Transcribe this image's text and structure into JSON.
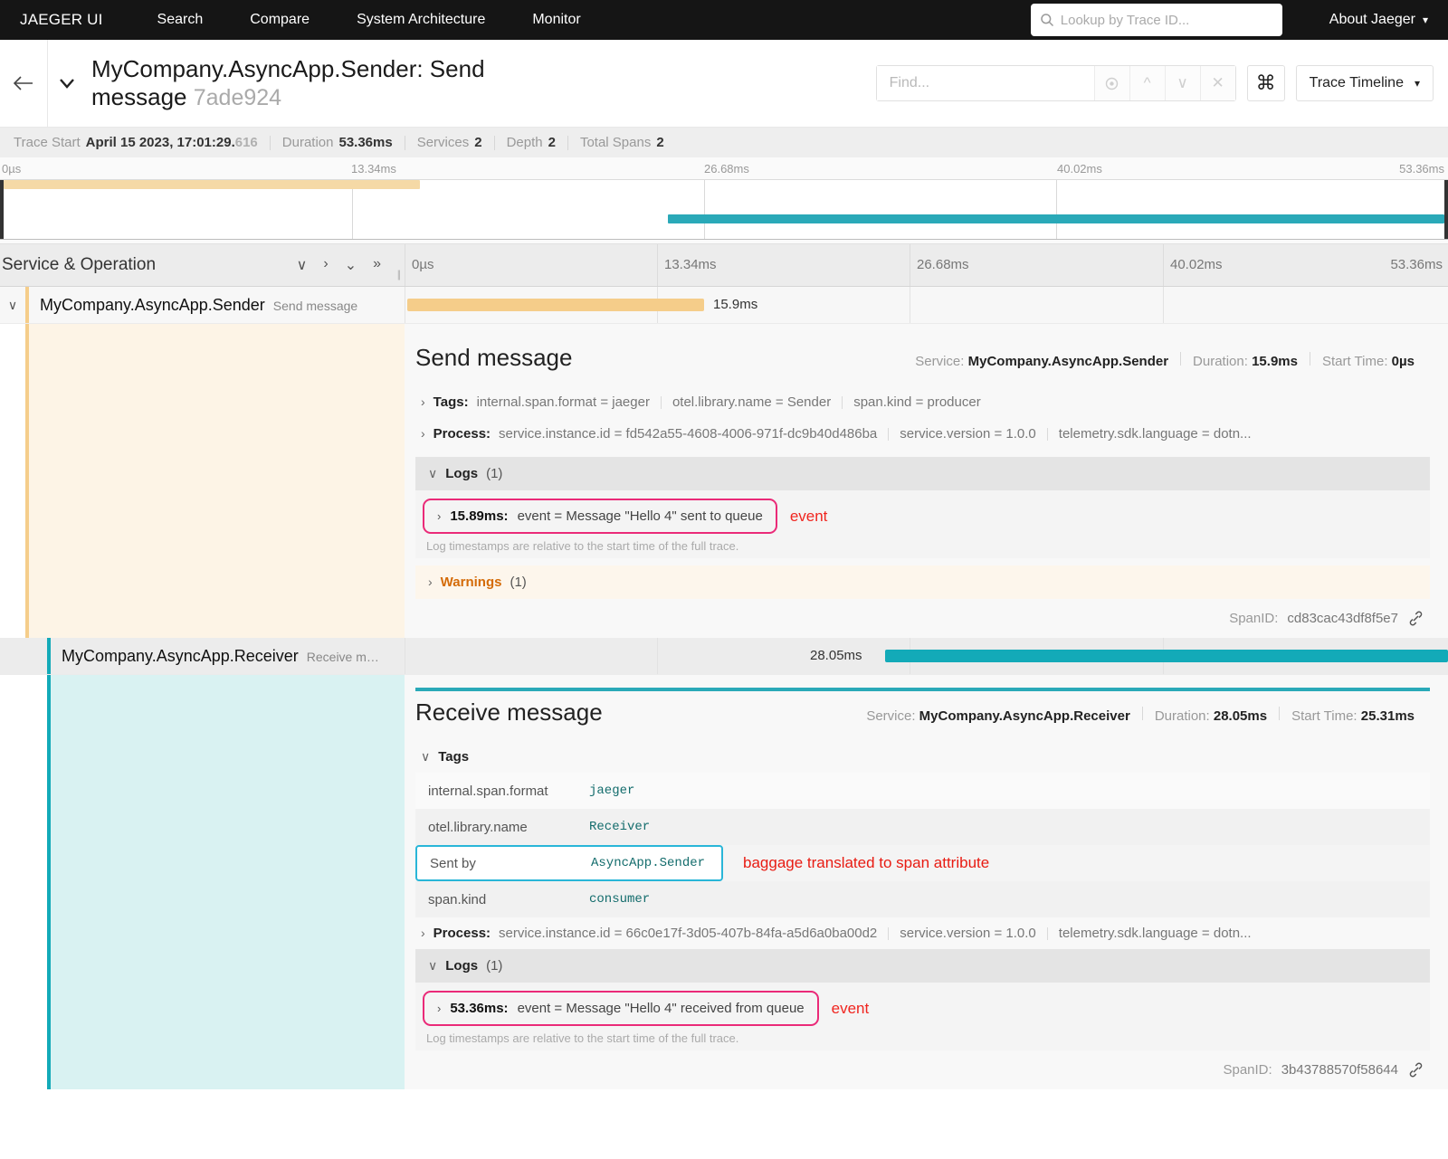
{
  "nav": {
    "brand": "JAEGER UI",
    "links": [
      "Search",
      "Compare",
      "System Architecture",
      "Monitor"
    ],
    "lookup_placeholder": "Lookup by Trace ID...",
    "lookup_value": "",
    "about": "About Jaeger"
  },
  "trace_header": {
    "title": "MyCompany.AsyncApp.Sender: Send message",
    "trace_id": "7ade924",
    "find_placeholder": "Find...",
    "find_value": "",
    "view_mode": "Trace Timeline"
  },
  "meta": {
    "trace_start_label": "Trace Start",
    "trace_start_value": "April 15 2023, 17:01:29.",
    "trace_start_frac": "616",
    "duration_label": "Duration",
    "duration_value": "53.36ms",
    "services_label": "Services",
    "services_value": "2",
    "depth_label": "Depth",
    "depth_value": "2",
    "spans_label": "Total Spans",
    "spans_value": "2"
  },
  "timeline": {
    "ticks": [
      "0µs",
      "13.34ms",
      "26.68ms",
      "40.02ms",
      "53.36ms"
    ],
    "total_ms": 53.36
  },
  "columns": {
    "service_operation": "Service & Operation",
    "ticks": [
      "0µs",
      "13.34ms",
      "26.68ms",
      "40.02ms",
      "53.36ms"
    ]
  },
  "colors": {
    "sender": "#f5cd8a",
    "receiver": "#2aa9b8",
    "annotation_pink": "#ea2a78",
    "annotation_red": "#e81b12",
    "highlight_blue": "#29b6d8",
    "warning": "#d46b08"
  },
  "spans": [
    {
      "service": "MyCompany.AsyncApp.Sender",
      "operation": "Send message",
      "duration_label": "15.9ms",
      "start_pct": 0,
      "width_pct": 29.8,
      "detail": {
        "title": "Send message",
        "service_label": "Service:",
        "service_value": "MyCompany.AsyncApp.Sender",
        "duration_label": "Duration:",
        "duration_value": "15.9ms",
        "start_label": "Start Time:",
        "start_value": "0µs",
        "tags_label": "Tags:",
        "tags_inline": [
          "internal.span.format = jaeger",
          "otel.library.name = Sender",
          "span.kind = producer"
        ],
        "process_label": "Process:",
        "process_inline": [
          "service.instance.id = fd542a55-4608-4006-971f-dc9b40d486ba",
          "service.version = 1.0.0",
          "telemetry.sdk.language = dotn..."
        ],
        "logs_label": "Logs",
        "logs_count": "(1)",
        "log_time": "15.89ms:",
        "log_kv": "event = Message \"Hello 4\" sent to queue",
        "log_annotation": "event",
        "log_note": "Log timestamps are relative to the start time of the full trace.",
        "warnings_label": "Warnings",
        "warnings_count": "(1)",
        "spanid_label": "SpanID:",
        "spanid_value": "cd83cac43df8f5e7"
      }
    },
    {
      "service": "MyCompany.AsyncApp.Receiver",
      "operation": "Receive m…",
      "duration_label": "28.05ms",
      "start_pct": 47.4,
      "width_pct": 52.6,
      "detail": {
        "title": "Receive message",
        "service_label": "Service:",
        "service_value": "MyCompany.AsyncApp.Receiver",
        "duration_label": "Duration:",
        "duration_value": "28.05ms",
        "start_label": "Start Time:",
        "start_value": "25.31ms",
        "tags_label": "Tags",
        "tags_table": [
          {
            "key": "internal.span.format",
            "value": "jaeger",
            "highlight": false
          },
          {
            "key": "otel.library.name",
            "value": "Receiver",
            "highlight": false
          },
          {
            "key": "Sent by",
            "value": "AsyncApp.Sender",
            "highlight": true,
            "annotation": "baggage translated to span attribute"
          },
          {
            "key": "span.kind",
            "value": "consumer",
            "highlight": false
          }
        ],
        "process_label": "Process:",
        "process_inline": [
          "service.instance.id = 66c0e17f-3d05-407b-84fa-a5d6a0ba00d2",
          "service.version = 1.0.0",
          "telemetry.sdk.language = dotn..."
        ],
        "logs_label": "Logs",
        "logs_count": "(1)",
        "log_time": "53.36ms:",
        "log_kv": "event = Message \"Hello 4\" received from queue",
        "log_annotation": "event",
        "log_note": "Log timestamps are relative to the start time of the full trace.",
        "spanid_label": "SpanID:",
        "spanid_value": "3b43788570f58644"
      }
    }
  ]
}
